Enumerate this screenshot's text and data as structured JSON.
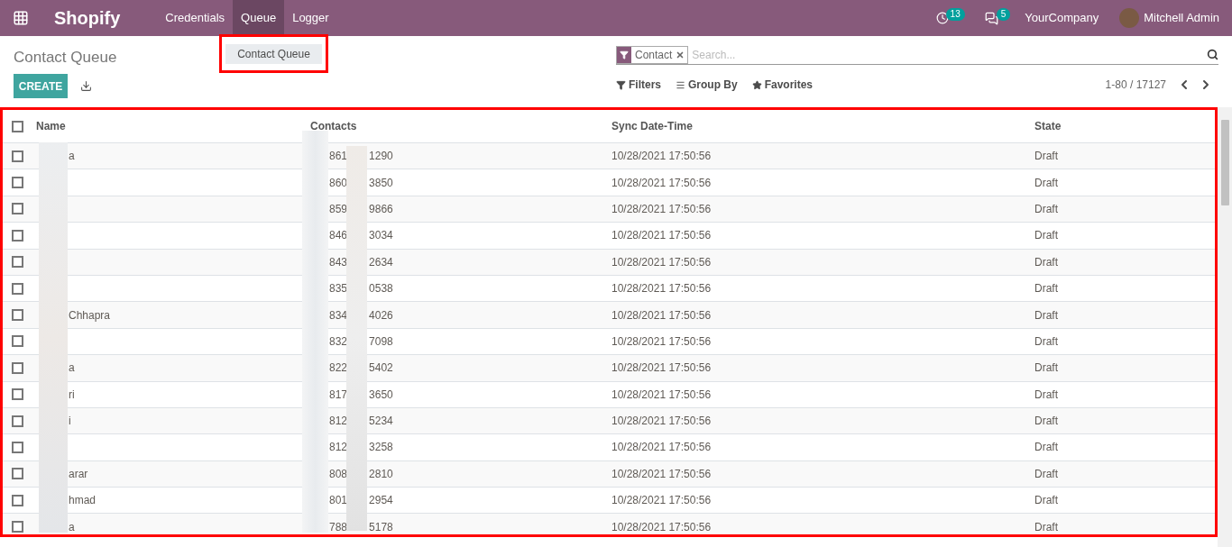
{
  "navbar": {
    "app": "Shopify",
    "menus": [
      {
        "label": "Credentials",
        "selected": false
      },
      {
        "label": "Queue",
        "selected": true
      },
      {
        "label": "Logger",
        "selected": false
      }
    ],
    "activity_count": "13",
    "message_count": "5",
    "company": "YourCompany",
    "user": "Mitchell Admin"
  },
  "dropdown": {
    "items": [
      "Contact Queue"
    ]
  },
  "breadcrumb": "Contact Queue",
  "create_button": "CREATE",
  "search": {
    "facet": "Contact",
    "placeholder": "Search..."
  },
  "filters": [
    "Filters",
    "Group By",
    "Favorites"
  ],
  "pager": "1-80 / 17127",
  "table": {
    "columns": [
      "Name",
      "Contacts",
      "Sync Date-Time",
      "State"
    ],
    "all_checked": false,
    "rows": [
      {
        "checked": false,
        "name_end": "a",
        "contact_start": "861",
        "contact_end": "1290",
        "sync": "10/28/2021 17:50:56",
        "state": "Draft"
      },
      {
        "checked": false,
        "contact_start": "860",
        "contact_end": "3850",
        "sync": "10/28/2021 17:50:56",
        "state": "Draft"
      },
      {
        "checked": false,
        "contact_start": "859",
        "contact_end": "9866",
        "sync": "10/28/2021 17:50:56",
        "state": "Draft"
      },
      {
        "checked": false,
        "contact_start": "846",
        "contact_end": "3034",
        "sync": "10/28/2021 17:50:56",
        "state": "Draft"
      },
      {
        "checked": false,
        "contact_start": "843",
        "contact_end": "2634",
        "sync": "10/28/2021 17:50:56",
        "state": "Draft"
      },
      {
        "checked": false,
        "contact_start": "835",
        "contact_end": "0538",
        "sync": "10/28/2021 17:50:56",
        "state": "Draft"
      },
      {
        "checked": false,
        "name_end": "Chhapra",
        "contact_start": "834",
        "contact_end": "4026",
        "sync": "10/28/2021 17:50:56",
        "state": "Draft"
      },
      {
        "checked": false,
        "contact_start": "832",
        "contact_end": "7098",
        "sync": "10/28/2021 17:50:56",
        "state": "Draft"
      },
      {
        "checked": false,
        "name_end": "a",
        "contact_start": "822",
        "contact_end": "5402",
        "sync": "10/28/2021 17:50:56",
        "state": "Draft"
      },
      {
        "checked": false,
        "name_end": "ri",
        "contact_start": "817",
        "contact_end": "3650",
        "sync": "10/28/2021 17:50:56",
        "state": "Draft"
      },
      {
        "checked": false,
        "name_end": "i",
        "contact_start": "812",
        "contact_end": "5234",
        "sync": "10/28/2021 17:50:56",
        "state": "Draft"
      },
      {
        "checked": false,
        "contact_start": "812",
        "contact_end": "3258",
        "sync": "10/28/2021 17:50:56",
        "state": "Draft"
      },
      {
        "checked": false,
        "name_end": "arar",
        "contact_start": "808",
        "contact_end": "2810",
        "sync": "10/28/2021 17:50:56",
        "state": "Draft"
      },
      {
        "checked": false,
        "name_end": "hmad",
        "contact_start": "801",
        "contact_end": "2954",
        "sync": "10/28/2021 17:50:56",
        "state": "Draft"
      },
      {
        "checked": false,
        "name_end": "a",
        "contact_start": "788",
        "contact_end": "5178",
        "sync": "10/28/2021 17:50:56",
        "state": "Draft"
      }
    ]
  }
}
